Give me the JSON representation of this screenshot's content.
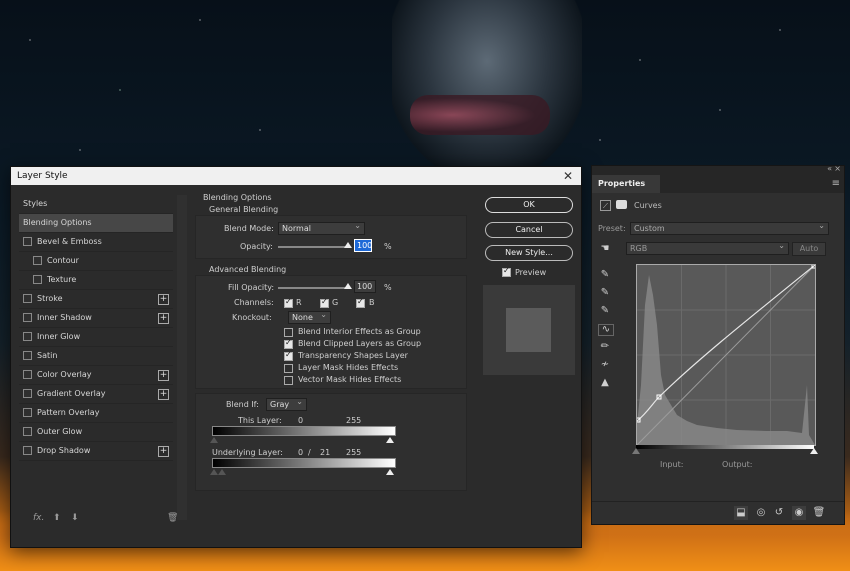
{
  "dialog": {
    "title": "Layer Style",
    "styles_header": "Styles",
    "style_items": [
      {
        "label": "Blending Options"
      },
      {
        "label": "Bevel & Emboss"
      },
      {
        "label": "Contour"
      },
      {
        "label": "Texture"
      },
      {
        "label": "Stroke"
      },
      {
        "label": "Inner Shadow"
      },
      {
        "label": "Inner Glow"
      },
      {
        "label": "Satin"
      },
      {
        "label": "Color Overlay"
      },
      {
        "label": "Gradient Overlay"
      },
      {
        "label": "Pattern Overlay"
      },
      {
        "label": "Outer Glow"
      },
      {
        "label": "Drop Shadow"
      }
    ],
    "footer_fx": "fx.",
    "blending": {
      "title": "Blending Options",
      "general_title": "General Blending",
      "blend_mode_label": "Blend Mode:",
      "blend_mode_value": "Normal",
      "opacity_label": "Opacity:",
      "opacity_value": "100",
      "percent": "%",
      "advanced_title": "Advanced Blending",
      "fill_opacity_label": "Fill Opacity:",
      "fill_opacity_value": "100",
      "channels_label": "Channels:",
      "channel_r": "R",
      "channel_g": "G",
      "channel_b": "B",
      "knockout_label": "Knockout:",
      "knockout_value": "None",
      "options": [
        {
          "label": "Blend Interior Effects as Group",
          "checked": false
        },
        {
          "label": "Blend Clipped Layers as Group",
          "checked": true
        },
        {
          "label": "Transparency Shapes Layer",
          "checked": true
        },
        {
          "label": "Layer Mask Hides Effects",
          "checked": false
        },
        {
          "label": "Vector Mask Hides Effects",
          "checked": false
        }
      ],
      "blend_if_label": "Blend If:",
      "blend_if_value": "Gray",
      "this_layer_label": "This Layer:",
      "this_layer_low": "0",
      "this_layer_high": "255",
      "underlying_label": "Underlying Layer:",
      "underlying_low": "0",
      "underlying_sep": "/",
      "underlying_mid": "21",
      "underlying_high": "255"
    },
    "buttons": {
      "ok": "OK",
      "cancel": "Cancel",
      "new_style": "New Style..."
    },
    "preview_label": "Preview"
  },
  "properties": {
    "tab": "Properties",
    "adjustment_name": "Curves",
    "preset_label": "Preset:",
    "preset_value": "Custom",
    "channel_value": "RGB",
    "auto_label": "Auto",
    "input_label": "Input:",
    "output_label": "Output:"
  }
}
